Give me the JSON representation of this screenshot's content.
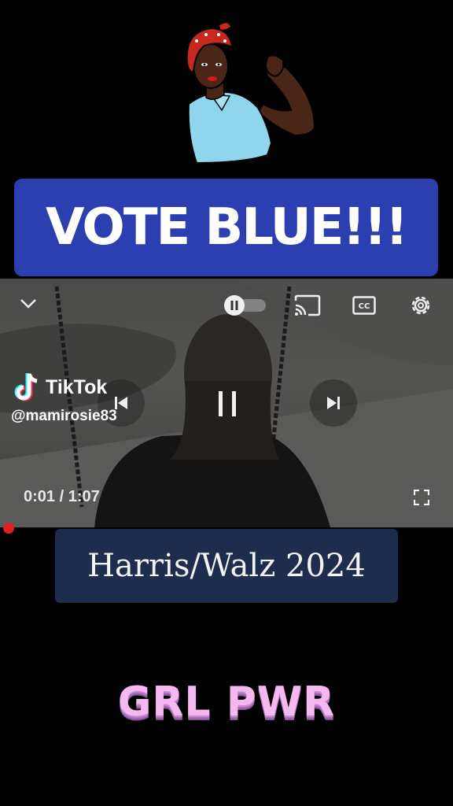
{
  "banner": {
    "vote_text": "VOTE BLUE!!!",
    "color": "#2b3fb0"
  },
  "player": {
    "time": "0:01 / 1:07",
    "progress_fraction": 0.015,
    "state": "playing",
    "icons": [
      "chevron-down-icon",
      "autoplay-toggle-icon",
      "cast-icon",
      "captions-icon",
      "settings-icon",
      "previous-icon",
      "pause-icon",
      "next-icon",
      "fullscreen-icon"
    ]
  },
  "watermark": {
    "brand": "TikTok",
    "handle": "@mamirosie83"
  },
  "caption_banner": {
    "text": "Harris/Walz 2024",
    "color": "#1d2d4d"
  },
  "footer": {
    "text": "GRL PWR",
    "color": "#f5b8f0"
  }
}
